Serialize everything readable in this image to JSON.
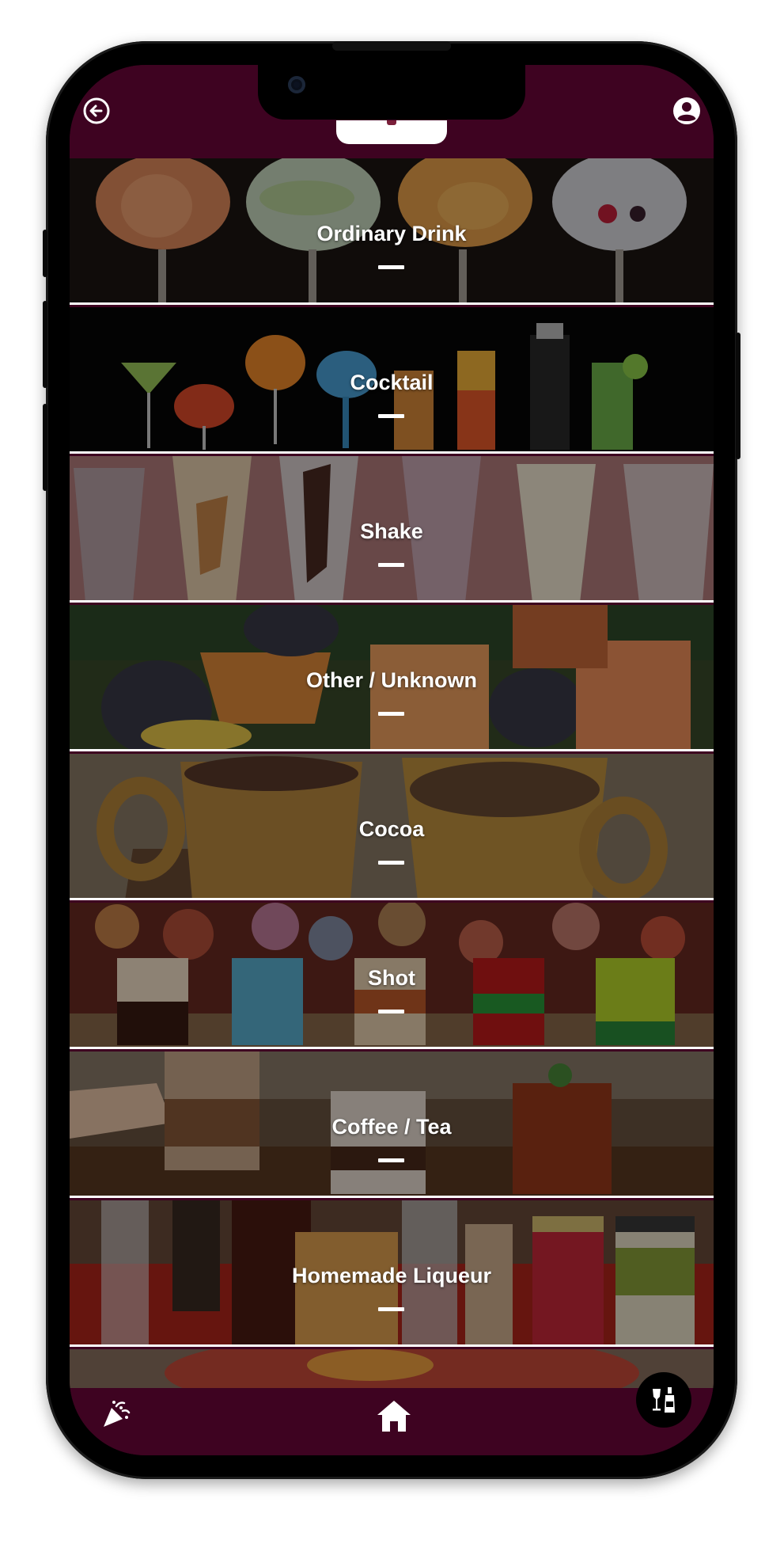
{
  "app": {
    "header": {
      "back_icon": "arrow-left-circle-icon",
      "account_icon": "account-circle-icon"
    },
    "colors": {
      "primary": "#3e0321",
      "tile_divider": "#ffffff",
      "text": "#ffffff"
    },
    "categories": [
      {
        "label": "Ordinary Drink",
        "image": "gin-tonic-glasses"
      },
      {
        "label": "Cocktail",
        "image": "cocktail-lineup"
      },
      {
        "label": "Shake",
        "image": "milkshakes"
      },
      {
        "label": "Other / Unknown",
        "image": "fruit-drinks"
      },
      {
        "label": "Cocoa",
        "image": "cocoa-mugs"
      },
      {
        "label": "Shot",
        "image": "layered-shots"
      },
      {
        "label": "Coffee / Tea",
        "image": "iced-coffee-tea"
      },
      {
        "label": "Homemade Liqueur",
        "image": "liqueur-bottles"
      },
      {
        "label": "",
        "image": "punch-bowl"
      }
    ],
    "bottom_nav": {
      "left_icon": "party-popper-icon",
      "center_icon": "home-icon",
      "right_icon": "bottles-icon"
    }
  }
}
